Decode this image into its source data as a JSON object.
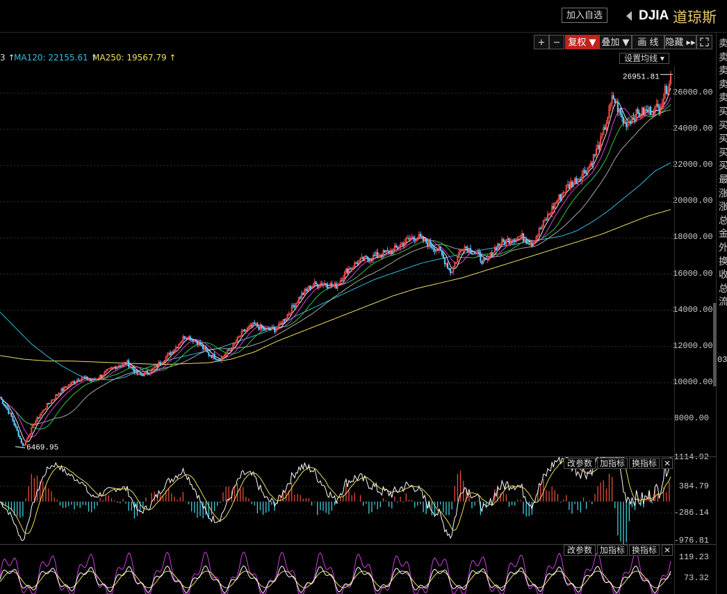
{
  "header": {
    "add_watchlist": "加入自选",
    "symbol": "DJIA",
    "name": "道琼斯"
  },
  "toolbar": {
    "plus": "+",
    "minus": "−",
    "restore_rights": "复权 ▼",
    "overlay": "叠加 ▼",
    "draw": "画 线",
    "hide": "隐藏 ▸▸",
    "expand_icon": "fullscreen-icon"
  },
  "ma_legend": {
    "cut_prefix": "3 ↑",
    "ma120": "MA120: 22155.61 ↑",
    "ma250": "MA250: 19567.79 ↑",
    "ma120_color": "#2fc0e0",
    "ma250_color": "#f0e060",
    "set_ma_button": "设置均线 ▾"
  },
  "indicator_buttons": {
    "change_params": "改参数",
    "add_indicator": "加指标",
    "switch_indicator": "换指标",
    "close": "✕"
  },
  "right_panel_chars": [
    "卖",
    "卖",
    "卖",
    "卖",
    "卖",
    "买",
    "买",
    "买",
    "买",
    "买",
    "最",
    "涨",
    "涨",
    "总",
    "金",
    "外",
    "换",
    "收",
    "总",
    "流"
  ],
  "right_panel_tag": "03",
  "chart_data": {
    "main": {
      "type": "line",
      "yticks": [
        8000,
        10000,
        12000,
        14000,
        16000,
        18000,
        20000,
        22000,
        24000,
        26000
      ],
      "ytick_labels": [
        "8000.00",
        "10000.00",
        "12000.00",
        "14000.00",
        "16000.00",
        "18000.00",
        "20000.00",
        "22000.00",
        "24000.00",
        "26000.00"
      ],
      "ylim": [
        6000,
        27500
      ],
      "max_label": "26951.81",
      "min_label": "6469.95",
      "price_close": [
        9200,
        8100,
        6470,
        7800,
        8700,
        9400,
        9900,
        10300,
        10100,
        10500,
        10900,
        11100,
        10400,
        10600,
        11200,
        11800,
        12600,
        12300,
        11600,
        11300,
        11900,
        12800,
        13200,
        12900,
        13000,
        13900,
        14800,
        15400,
        15500,
        15300,
        16200,
        16700,
        16900,
        17100,
        17300,
        17800,
        18100,
        17700,
        17300,
        16100,
        17600,
        17200,
        16600,
        17600,
        17900,
        18100,
        17700,
        18800,
        19900,
        20800,
        21300,
        22000,
        23400,
        25800,
        24300,
        24800,
        25000,
        25200,
        26900
      ],
      "ma120": [
        12400,
        11800,
        11200,
        10800,
        10500,
        10300,
        10200,
        10150,
        10300,
        10700,
        11000,
        11300,
        11500,
        11700,
        11900,
        12200,
        12500,
        12800,
        13200,
        13700,
        14100,
        14500,
        14900,
        15300,
        15700,
        16000,
        16300,
        16600,
        16800,
        17000,
        17200,
        17350,
        17500,
        17650,
        17800,
        17950,
        18100,
        18400,
        18900,
        19500,
        20200,
        20900,
        21700,
        22155
      ],
      "ma250": [
        11500,
        11300,
        11200,
        11200,
        11150,
        11100,
        11050,
        11000,
        11050,
        11100,
        11300,
        11700,
        12300,
        12800,
        13300,
        13800,
        14300,
        14800,
        15200,
        15500,
        15800,
        16200,
        16600,
        17000,
        17400,
        17800,
        18200,
        18700,
        19200,
        19567
      ],
      "price_color_up": "#ff4d4d",
      "price_color_down": "#5ec8ff"
    },
    "macd": {
      "type": "bar",
      "yticks": [
        "1114.92",
        "384.79",
        "-286.14",
        "-976.81"
      ],
      "ylim": [
        -976.81,
        1114.92
      ]
    },
    "kdj": {
      "type": "line",
      "yticks": [
        "119.23",
        "73.32"
      ]
    }
  }
}
